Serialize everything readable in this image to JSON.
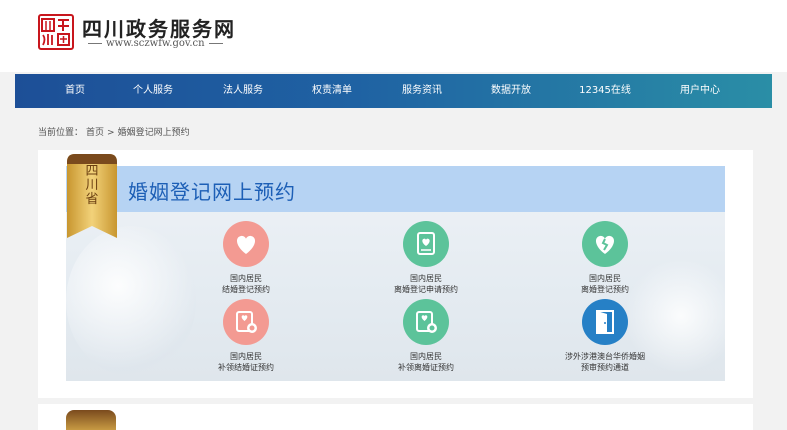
{
  "site": {
    "title": "四川政务服务网",
    "url": "www.sczwfw.gov.cn"
  },
  "nav": {
    "items": [
      {
        "label": "首页"
      },
      {
        "label": "个人服务"
      },
      {
        "label": "法人服务"
      },
      {
        "label": "权责清单"
      },
      {
        "label": "服务资讯"
      },
      {
        "label": "数据开放"
      },
      {
        "label": "12345在线"
      },
      {
        "label": "用户中心"
      }
    ]
  },
  "breadcrumb": {
    "prefix": "当前位置：",
    "home": "首页",
    "separator": ">",
    "current": "婚姻登记网上预约"
  },
  "banner": {
    "ribbon_text": "四川省",
    "title": "婚姻登记网上预约"
  },
  "services": [
    {
      "line1": "国内居民",
      "line2": "结婚登记预约",
      "icon": "heart-icon",
      "color": "#f39a92"
    },
    {
      "line1": "国内居民",
      "line2": "离婚登记申请预约",
      "icon": "document-heart-icon",
      "color": "#5cc39a"
    },
    {
      "line1": "国内居民",
      "line2": "离婚登记预约",
      "icon": "broken-heart-icon",
      "color": "#5cc39a"
    },
    {
      "line1": "国内居民",
      "line2": "补领结婚证预约",
      "icon": "certificate-icon",
      "color": "#f39a92"
    },
    {
      "line1": "国内居民",
      "line2": "补领离婚证预约",
      "icon": "certificate-icon",
      "color": "#5cc39a"
    },
    {
      "line1": "涉外涉港澳台华侨婚姻",
      "line2": "预审预约通道",
      "icon": "door-icon",
      "color": "#2680c6"
    }
  ],
  "colors": {
    "brand_red": "#c8161d",
    "nav_blue": "#1d4f97",
    "nav_teal": "#2a8ea6",
    "title_blue": "#1d5fb6",
    "gold": "#c79a43"
  }
}
